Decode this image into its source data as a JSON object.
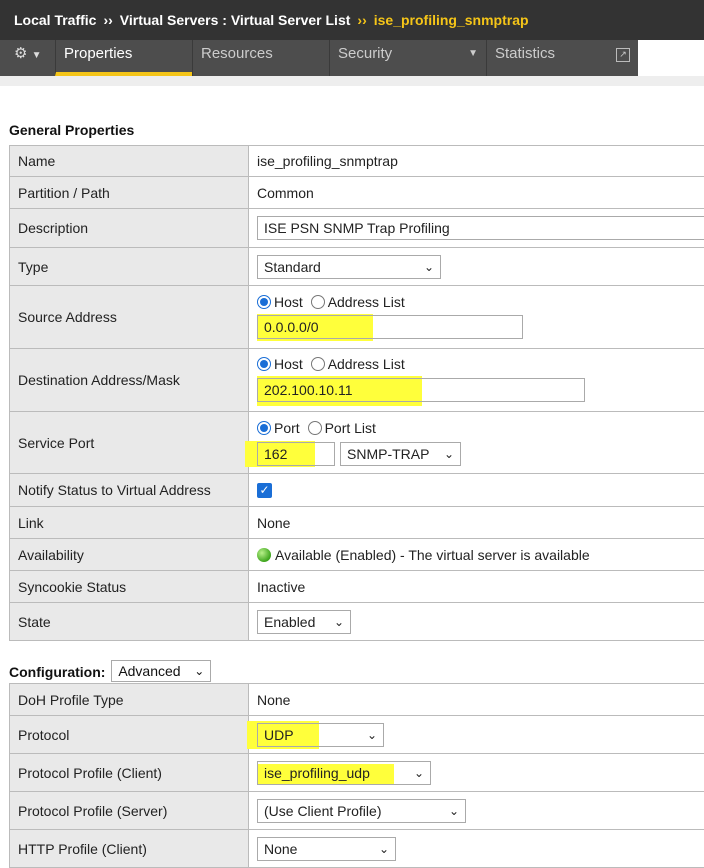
{
  "breadcrumb": {
    "root": "Local Traffic",
    "separator": "››",
    "section": "Virtual Servers : Virtual Server List",
    "current": "ise_profiling_snmptrap"
  },
  "tabs": {
    "gear_icon": "gear-icon",
    "items": [
      {
        "label": "Properties",
        "active": true
      },
      {
        "label": "Resources"
      },
      {
        "label": "Security",
        "has_dropdown": true
      },
      {
        "label": "Statistics",
        "has_external": true
      }
    ]
  },
  "general": {
    "title": "General Properties",
    "name": {
      "label": "Name",
      "value": "ise_profiling_snmptrap"
    },
    "partition": {
      "label": "Partition / Path",
      "value": "Common"
    },
    "description": {
      "label": "Description",
      "value": "ISE PSN SNMP Trap Profiling"
    },
    "type": {
      "label": "Type",
      "value": "Standard"
    },
    "source": {
      "label": "Source Address",
      "radio_host": "Host",
      "radio_list": "Address List",
      "value": "0.0.0.0/0"
    },
    "destination": {
      "label": "Destination Address/Mask",
      "radio_host": "Host",
      "radio_list": "Address List",
      "value": "202.100.10.11"
    },
    "service_port": {
      "label": "Service Port",
      "radio_port": "Port",
      "radio_list": "Port List",
      "port": "162",
      "service": "SNMP-TRAP"
    },
    "notify": {
      "label": "Notify Status to Virtual Address",
      "checked": true
    },
    "link": {
      "label": "Link",
      "value": "None"
    },
    "availability": {
      "label": "Availability",
      "value": "Available (Enabled) - The virtual server is available"
    },
    "syncookie": {
      "label": "Syncookie Status",
      "value": "Inactive"
    },
    "state": {
      "label": "State",
      "value": "Enabled"
    }
  },
  "configuration": {
    "title": "Configuration:",
    "mode": "Advanced",
    "doh": {
      "label": "DoH Profile Type",
      "value": "None"
    },
    "protocol": {
      "label": "Protocol",
      "value": "UDP"
    },
    "profile_client": {
      "label": "Protocol Profile (Client)",
      "value": "ise_profiling_udp"
    },
    "profile_server": {
      "label": "Protocol Profile (Server)",
      "value": "(Use Client Profile)"
    },
    "http_client": {
      "label": "HTTP Profile (Client)",
      "value": "None"
    }
  },
  "colors": {
    "highlight": "#ffff3b",
    "accent": "#f5c518",
    "topbar": "#333333",
    "radio": "#1a6ed6"
  }
}
